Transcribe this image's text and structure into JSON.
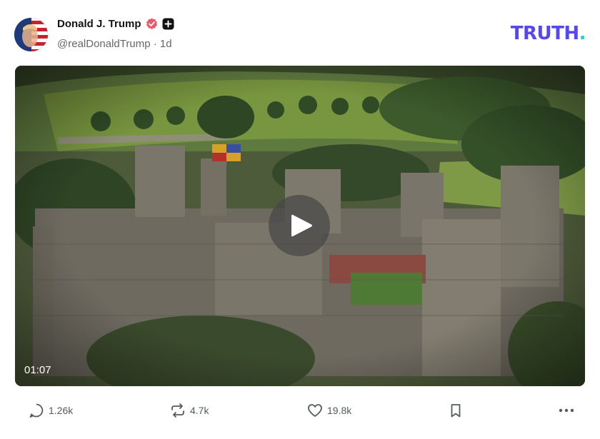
{
  "post": {
    "author": {
      "display_name": "Donald J. Trump",
      "handle": "@realDonaldTrump",
      "age": "1d",
      "separator": "·",
      "verified_icon": "verified-badge-icon",
      "plus_icon": "plus-badge-icon"
    },
    "brand": {
      "logo_text": "TRUTH",
      "logo_dot": ".",
      "logo_color": "#5448ee",
      "dot_color": "#1ad6c2"
    },
    "media": {
      "type": "video",
      "duration": "01:07",
      "play_icon": "play-icon"
    },
    "actions": {
      "reply_count": "1.26k",
      "retruth_count": "4.7k",
      "like_count": "19.8k",
      "reply_icon": "comment-icon",
      "retruth_icon": "repost-icon",
      "like_icon": "heart-icon",
      "bookmark_icon": "bookmark-icon",
      "more_icon": "more-icon"
    }
  }
}
